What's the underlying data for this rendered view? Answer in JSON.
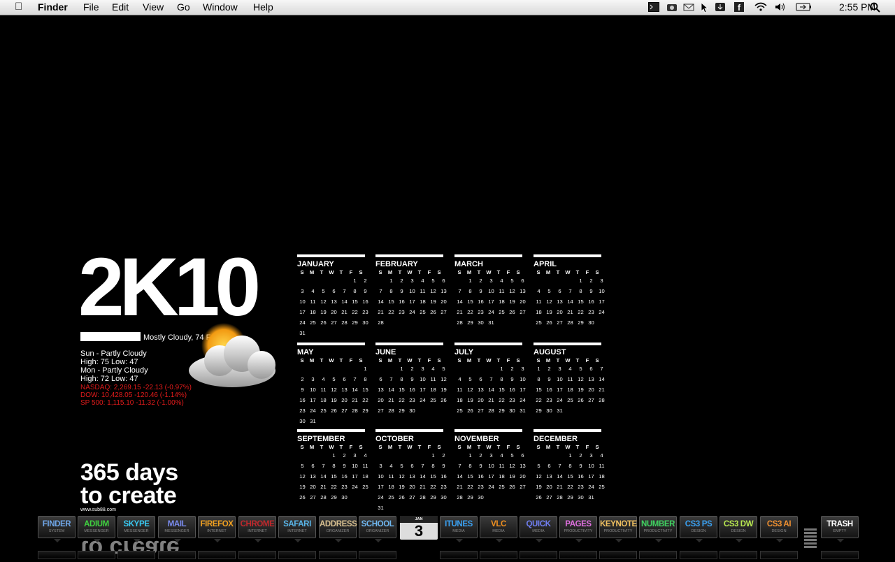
{
  "menubar": {
    "apple": "",
    "app": "Finder",
    "menus": [
      "File",
      "Edit",
      "View",
      "Go",
      "Window",
      "Help"
    ],
    "clock": "2:55 PM",
    "tray_icons": [
      "terminal-icon",
      "camera-icon",
      "mail-icon",
      "cursor-icon",
      "download-icon",
      "facebook-icon",
      "wifi-icon",
      "volume-icon",
      "battery-icon",
      "spotlight-icon"
    ]
  },
  "widget": {
    "title": "2K10",
    "current": "Mostly Cloudy, 74 F",
    "forecast": [
      "Sun - Partly Cloudy",
      "High: 75  Low: 47",
      "Mon - Partly Cloudy",
      "High: 72  Low: 47"
    ],
    "stocks": [
      "NASDAQ: 2,269.15 -22.13 (-0.97%)",
      "DOW: 10,428.05 -120.46 (-1.14%)",
      "SP 500: 1,115.10 -11.32 (-1.00%)"
    ]
  },
  "calendar": {
    "dow": [
      "S",
      "M",
      "T",
      "W",
      "T",
      "F",
      "S"
    ],
    "months": [
      {
        "name": "JANUARY",
        "start": 5,
        "days": 31
      },
      {
        "name": "FEBRUARY",
        "start": 1,
        "days": 28
      },
      {
        "name": "MARCH",
        "start": 1,
        "days": 31
      },
      {
        "name": "APRIL",
        "start": 4,
        "days": 30
      },
      {
        "name": "MAY",
        "start": 6,
        "days": 31
      },
      {
        "name": "JUNE",
        "start": 2,
        "days": 30
      },
      {
        "name": "JULY",
        "start": 4,
        "days": 31
      },
      {
        "name": "AUGUST",
        "start": 0,
        "days": 31
      },
      {
        "name": "SEPTEMBER",
        "start": 3,
        "days": 30
      },
      {
        "name": "OCTOBER",
        "start": 5,
        "days": 31
      },
      {
        "name": "NOVEMBER",
        "start": 1,
        "days": 30
      },
      {
        "name": "DECEMBER",
        "start": 3,
        "days": 31
      }
    ]
  },
  "tagline": {
    "line1": "365 days",
    "line2": "to create",
    "site": "www.sub88.com"
  },
  "dock": {
    "items": [
      {
        "label": "FINDER",
        "sub": "SYSTEM",
        "color": "#6fa6e8"
      },
      {
        "label": "ADIUM",
        "sub": "MESSENGER",
        "color": "#3fd13f"
      },
      {
        "label": "SKYPE",
        "sub": "MESSENGER",
        "color": "#39c8f0"
      },
      {
        "label": "MAIL",
        "sub": "MESSENGER",
        "color": "#7a8cf0"
      },
      {
        "label": "FIREFOX",
        "sub": "INTERNET",
        "color": "#f0a020"
      },
      {
        "label": "CHROME",
        "sub": "INTERNET",
        "color": "#c0282c"
      },
      {
        "label": "SAFARI",
        "sub": "INTERNET",
        "color": "#59b5e8"
      },
      {
        "label": "ADDRESS",
        "sub": "ORGANIZER",
        "color": "#d8c090"
      },
      {
        "label": "SCHOOL",
        "sub": "ORGANIZER",
        "color": "#6fb7f0"
      },
      {
        "label": "ITUNES",
        "sub": "MEDIA",
        "color": "#3aa0f0"
      },
      {
        "label": "VLC",
        "sub": "MEDIA",
        "color": "#f09020"
      },
      {
        "label": "QUICK",
        "sub": "MEDIA",
        "color": "#6f7ef0"
      },
      {
        "label": "PAGES",
        "sub": "PRODUCTIVITY",
        "color": "#e070e0"
      },
      {
        "label": "KEYNOTE",
        "sub": "PRODUCTIVITY",
        "color": "#f0c060"
      },
      {
        "label": "NUMBER",
        "sub": "PRODUCTIVITY",
        "color": "#40d060"
      },
      {
        "label": "CS3 PS",
        "sub": "DESIGN",
        "color": "#3aa0f0"
      },
      {
        "label": "CS3 DW",
        "sub": "DESIGN",
        "color": "#b8e850"
      },
      {
        "label": "CS3 AI",
        "sub": "DESIGN",
        "color": "#f09030"
      },
      {
        "label": "TRASH",
        "sub": "EMPTY",
        "color": "#ffffff"
      }
    ],
    "calendar_tile": {
      "month": "JAN",
      "day": "3"
    }
  }
}
